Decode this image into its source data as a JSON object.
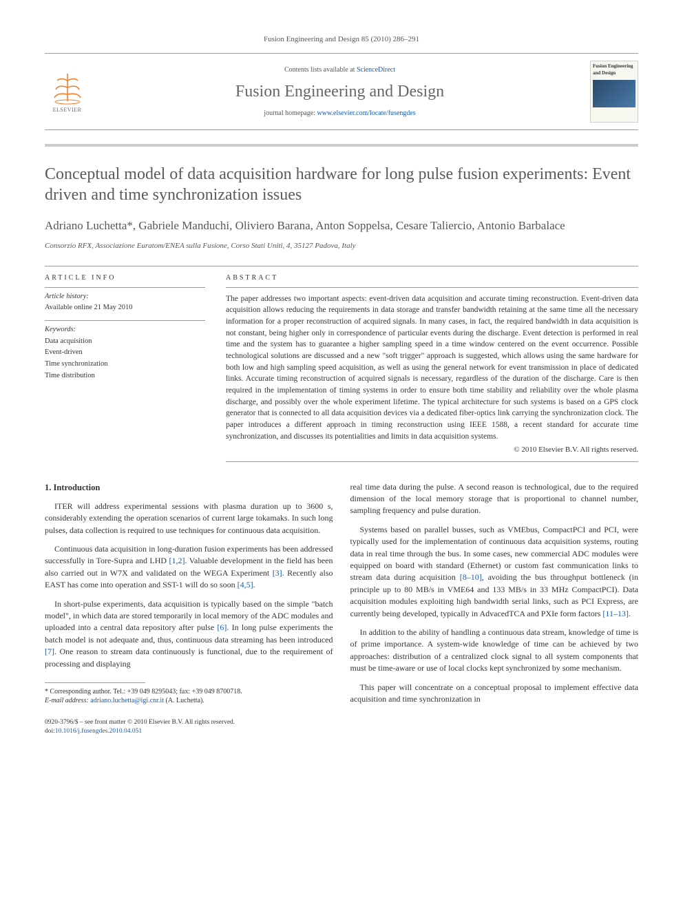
{
  "citation": "Fusion Engineering and Design 85 (2010) 286–291",
  "masthead": {
    "contents_prefix": "Contents lists available at ",
    "contents_link": "ScienceDirect",
    "journal_title": "Fusion Engineering and Design",
    "homepage_prefix": "journal homepage: ",
    "homepage_url": "www.elsevier.com/locate/fusengdes",
    "publisher": "ELSEVIER",
    "cover_title": "Fusion Engineering and Design"
  },
  "title": "Conceptual model of data acquisition hardware for long pulse fusion experiments: Event driven and time synchronization issues",
  "authors": "Adriano Luchetta*, Gabriele Manduchi, Oliviero Barana, Anton Soppelsa, Cesare Taliercio, Antonio Barbalace",
  "affiliation": "Consorzio RFX, Associazione Euratom/ENEA sulla Fusione, Corso Stati Uniti, 4, 35127 Padova, Italy",
  "article_info": {
    "label": "ARTICLE INFO",
    "history_label": "Article history:",
    "history_text": "Available online 21 May 2010",
    "keywords_label": "Keywords:",
    "keywords": [
      "Data acquisition",
      "Event-driven",
      "Time synchronization",
      "Time distribution"
    ]
  },
  "abstract": {
    "label": "ABSTRACT",
    "text": "The paper addresses two important aspects: event-driven data acquisition and accurate timing reconstruction. Event-driven data acquisition allows reducing the requirements in data storage and transfer bandwidth retaining at the same time all the necessary information for a proper reconstruction of acquired signals. In many cases, in fact, the required bandwidth in data acquisition is not constant, being higher only in correspondence of particular events during the discharge. Event detection is performed in real time and the system has to guarantee a higher sampling speed in a time window centered on the event occurrence. Possible technological solutions are discussed and a new \"soft trigger\" approach is suggested, which allows using the same hardware for both low and high sampling speed acquisition, as well as using the general network for event transmission in place of dedicated links. Accurate timing reconstruction of acquired signals is necessary, regardless of the duration of the discharge. Care is then required in the implementation of timing systems in order to ensure both time stability and reliability over the whole plasma discharge, and possibly over the whole experiment lifetime. The typical architecture for such systems is based on a GPS clock generator that is connected to all data acquisition devices via a dedicated fiber-optics link carrying the synchronization clock. The paper introduces a different approach in timing reconstruction using IEEE 1588, a recent standard for accurate time synchronization, and discusses its potentialities and limits in data acquisition systems.",
    "copyright": "© 2010 Elsevier B.V. All rights reserved."
  },
  "body": {
    "section_number": "1.",
    "section_title": "Introduction",
    "p1": "ITER will address experimental sessions with plasma duration up to 3600 s, considerably extending the operation scenarios of current large tokamaks. In such long pulses, data collection is required to use techniques for continuous data acquisition.",
    "p2a": "Continuous data acquisition in long-duration fusion experiments has been addressed successfully in Tore-Supra and LHD ",
    "p2_ref1": "[1,2]",
    "p2b": ". Valuable development in the field has been also carried out in W7X and validated on the WEGA Experiment ",
    "p2_ref2": "[3]",
    "p2c": ". Recently also EAST has come into operation and SST-1 will do so soon ",
    "p2_ref3": "[4,5]",
    "p2d": ".",
    "p3a": "In short-pulse experiments, data acquisition is typically based on the simple \"batch model\", in which data are stored temporarily in local memory of the ADC modules and uploaded into a central data repository after pulse ",
    "p3_ref1": "[6]",
    "p3b": ". In long pulse experiments the batch model is not adequate and, thus, continuous data streaming has been introduced ",
    "p3_ref2": "[7]",
    "p3c": ". One reason to stream data continuously is functional, due to the requirement of processing and displaying",
    "p4": "real time data during the pulse. A second reason is technological, due to the required dimension of the local memory storage that is proportional to channel number, sampling frequency and pulse duration.",
    "p5a": "Systems based on parallel busses, such as VMEbus, CompactPCI and PCI, were typically used for the implementation of continuous data acquisition systems, routing data in real time through the bus. In some cases, new commercial ADC modules were equipped on board with standard (Ethernet) or custom fast communication links to stream data during acquisition ",
    "p5_ref1": "[8–10]",
    "p5b": ", avoiding the bus throughput bottleneck (in principle up to 80 MB/s in VME64 and 133 MB/s in 33 MHz CompactPCI). Data acquisition modules exploiting high bandwidth serial links, such as PCI Express, are currently being developed, typically in AdvacedTCA and PXIe form factors ",
    "p5_ref2": "[11–13]",
    "p5c": ".",
    "p6": "In addition to the ability of handling a continuous data stream, knowledge of time is of prime importance. A system-wide knowledge of time can be achieved by two approaches: distribution of a centralized clock signal to all system components that must be time-aware or use of local clocks kept synchronized by some mechanism.",
    "p7": "This paper will concentrate on a conceptual proposal to implement effective data acquisition and time synchronization in"
  },
  "footnote": {
    "corresponding": "* Corresponding author. Tel.: +39 049 8295043; fax: +39 049 8700718.",
    "email_label": "E-mail address: ",
    "email": "adriano.luchetta@igi.cnr.it",
    "email_suffix": " (A. Luchetta)."
  },
  "footer": {
    "line1": "0920-3796/$ – see front matter © 2010 Elsevier B.V. All rights reserved.",
    "doi_prefix": "doi:",
    "doi": "10.1016/j.fusengdes.2010.04.051"
  }
}
